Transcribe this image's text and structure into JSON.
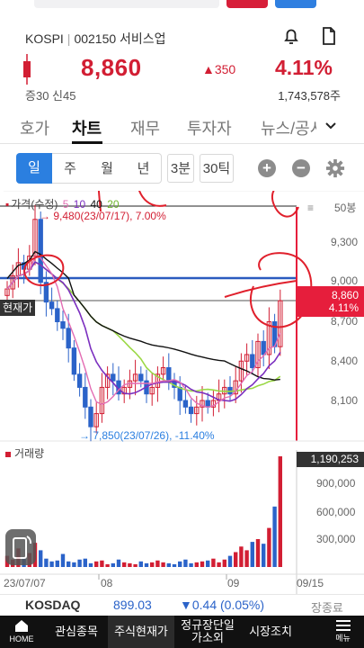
{
  "header": {
    "market": "KOSPI",
    "code": "002150",
    "name": "서비스업",
    "price": "8,860",
    "change": "350",
    "change_pct": "4.11%",
    "margin_info": "증30 신45",
    "volume": "1,743,578주"
  },
  "tabs": [
    "호가",
    "차트",
    "재무",
    "투자자",
    "뉴스/공시"
  ],
  "active_tab": "차트",
  "periods": {
    "items": [
      "일",
      "주",
      "월",
      "년"
    ],
    "minute": "3분",
    "tick": "30틱",
    "active": "일"
  },
  "chart": {
    "legend": {
      "price_label": "가격(수정)",
      "ma": [
        "5",
        "10",
        "40",
        "20"
      ]
    },
    "high_label": "9,480(23/07/17), 7.00%",
    "low_label": "7,850(23/07/26), -11.40%",
    "current_tag": "현재가",
    "price_tag_value": "8,860",
    "price_tag_pct": "4.11%",
    "y_ticks": [
      "9,300",
      "9,000",
      "8,700",
      "8,400",
      "8,100"
    ],
    "count_label": "50봉",
    "x_ticks": [
      "23/07/07",
      "08",
      "09",
      "09/15"
    ],
    "volume_title": "거래량",
    "volume_tag": "1,190,253",
    "volume_ticks": [
      "900,000",
      "600,000",
      "300,000"
    ],
    "colors": {
      "up": "#d21e33",
      "down": "#2b63c9",
      "ma5": "#e36cb3",
      "ma10": "#7b2fbf",
      "ma20": "#9bd845",
      "ma40": "#111111"
    }
  },
  "kosdaq": {
    "name": "KOSDAQ",
    "value": "899.03",
    "change": "▼0.44 (0.05%)",
    "status": "장종료"
  },
  "bottom_nav": [
    "HOME",
    "관심종목",
    "주식현재가",
    "정규장단일가소외",
    "시장조치",
    "메뉴"
  ]
}
